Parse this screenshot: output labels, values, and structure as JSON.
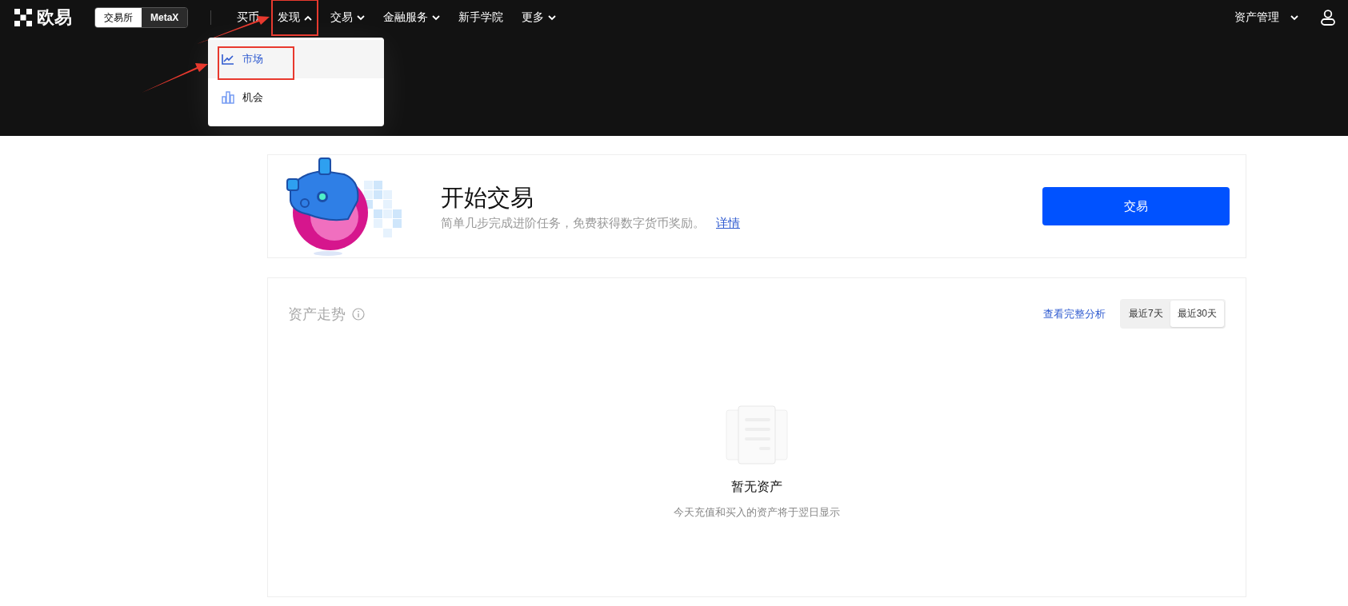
{
  "brand": {
    "name": "欧易"
  },
  "mode_switch": [
    {
      "label": "交易所",
      "selected": true
    },
    {
      "label": "MetaX",
      "selected": false
    }
  ],
  "nav": [
    {
      "label": "买币",
      "has_menu": false,
      "expanded": false,
      "annotated": false
    },
    {
      "label": "发现",
      "has_menu": true,
      "expanded": true,
      "annotated": true
    },
    {
      "label": "交易",
      "has_menu": true,
      "expanded": false,
      "annotated": false
    },
    {
      "label": "金融服务",
      "has_menu": true,
      "expanded": false,
      "annotated": false
    },
    {
      "label": "新手学院",
      "has_menu": false,
      "expanded": false,
      "annotated": false
    },
    {
      "label": "更多",
      "has_menu": true,
      "expanded": false,
      "annotated": false
    }
  ],
  "nav_menu": [
    {
      "label": "市场",
      "kind": "trend",
      "selected": true,
      "annotated": true
    },
    {
      "label": "机会",
      "kind": "opportunity",
      "selected": false,
      "annotated": false
    }
  ],
  "account": {
    "label": "资产管理"
  },
  "promo": {
    "title": "开始交易",
    "text": "简单几步完成进阶任务，免费获得数字货币奖励。",
    "link": "详情",
    "button": "交易"
  },
  "assets": {
    "title": "资产走势",
    "link": "查看完整分析",
    "ranges": [
      {
        "label": "最近7天",
        "selected": false
      },
      {
        "label": "最近30天",
        "selected": true
      }
    ],
    "empty_title": "暂无资产",
    "empty_text": "今天充值和买入的资产将于翌日显示"
  }
}
